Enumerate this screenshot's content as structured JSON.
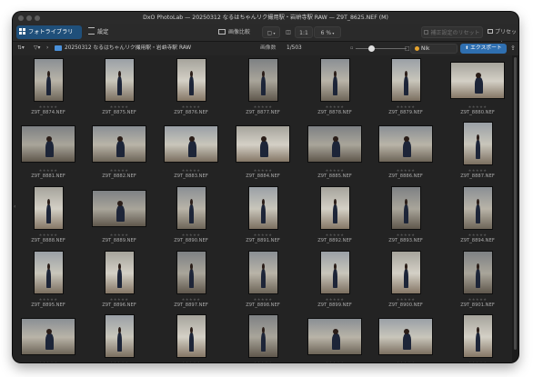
{
  "window": {
    "title": "DxO PhotoLab — 20250312 なるはちゃんリク撮用駅・岩峅寺駅 RAW — Z9T_8625.NEF (M)"
  },
  "toolbar": {
    "tab_library": "フォトライブラリ",
    "tab_settings": "設定",
    "compare_label": "画像比較",
    "ratio_label": "1:1",
    "zoom_value": "6 %",
    "reset_label": "補正設定のリセット",
    "preset_label": "プリセット"
  },
  "navbar": {
    "folder_path": "20250312 なるはちゃんリク撮用駅・岩峅寺駅 RAW",
    "count_label": "画像数",
    "count_value": "1/503",
    "nik_label": "Nik Collection",
    "export_label": "エクスポート"
  },
  "grid": {
    "stars": "★★★★★",
    "rows": [
      {
        "files": [
          "Z9T_8874.NEF",
          "Z9T_8875.NEF",
          "Z9T_8876.NEF",
          "Z9T_8877.NEF",
          "Z9T_8878.NEF",
          "Z9T_8879.NEF",
          "Z9T_8880.NEF"
        ]
      },
      {
        "files": [
          "Z9T_8881.NEF",
          "Z9T_8882.NEF",
          "Z9T_8883.NEF",
          "Z9T_8884.NEF",
          "Z9T_8885.NEF",
          "Z9T_8886.NEF",
          "Z9T_8887.NEF"
        ]
      },
      {
        "files": [
          "Z9T_8888.NEF",
          "Z9T_8889.NEF",
          "Z9T_8890.NEF",
          "Z9T_8891.NEF",
          "Z9T_8892.NEF",
          "Z9T_8893.NEF",
          "Z9T_8894.NEF"
        ]
      },
      {
        "files": [
          "Z9T_8895.NEF",
          "Z9T_8896.NEF",
          "Z9T_8897.NEF",
          "Z9T_8898.NEF",
          "Z9T_8899.NEF",
          "Z9T_8900.NEF",
          "Z9T_8901.NEF"
        ]
      },
      {
        "files": [
          "Z9T_8902.NEF",
          "Z9T_8903.NEF",
          "Z9T_8904.NEF",
          "Z9T_8905.NEF",
          "Z9T_8906.NEF",
          "Z9T_8907.NEF",
          "Z9T_8908.NEF"
        ]
      }
    ]
  },
  "colors": {
    "accent": "#2f6fb0",
    "background": "#212121",
    "active_tab": "#1f4f7a"
  }
}
